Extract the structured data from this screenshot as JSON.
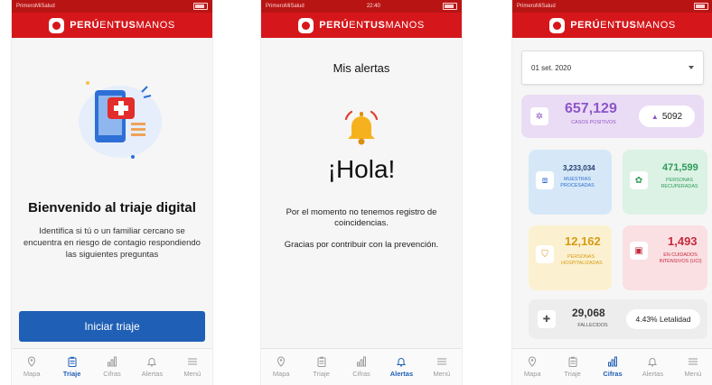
{
  "status": {
    "carrier": "PrimeroMiSalud",
    "time": "22:40"
  },
  "brand": {
    "bold1": "PERÚ",
    "light1": "EN",
    "bold2": "TUS",
    "light2": "MANOS"
  },
  "nav": {
    "mapa": "Mapa",
    "triaje": "Triaje",
    "cifras": "Cifras",
    "alertas": "Alertas",
    "menu": "Menú"
  },
  "screen1": {
    "title": "Bienvenido al triaje digital",
    "description": "Identifica si tú o un familiar cercano se encuentra en riesgo de contagio respondiendo las siguientes preguntas",
    "button": "Iniciar triaje"
  },
  "screen2": {
    "header": "Mis alertas",
    "greeting": "¡Hola!",
    "message1": "Por el momento no tenemos registro de coincidencias.",
    "message2": "Gracias por contribuir con la prevención."
  },
  "screen3": {
    "date": "01 set. 2020",
    "casos": {
      "value": "657,129",
      "label": "CASOS POSITIVOS",
      "delta": "5092"
    },
    "muestras": {
      "value": "3,233,034",
      "label": "MUESTRAS PROCESADAS"
    },
    "recuperados": {
      "value": "471,599",
      "label": "PERSONAS RECUPERADAS"
    },
    "hospitalizadas": {
      "value": "12,162",
      "label": "PERSONAS HOSPITALIZADAS"
    },
    "uci": {
      "value": "1,493",
      "label": "EN CUIDADOS INTENSIVOS (UCI)"
    },
    "fallecidos": {
      "value": "29,068",
      "label": "FALLECIDOS",
      "letalidad": "4.43% Letalidad"
    }
  },
  "colors": {
    "brand_red": "#d5171b",
    "primary_blue": "#1f5fb5",
    "purple": "#8e55c9"
  }
}
